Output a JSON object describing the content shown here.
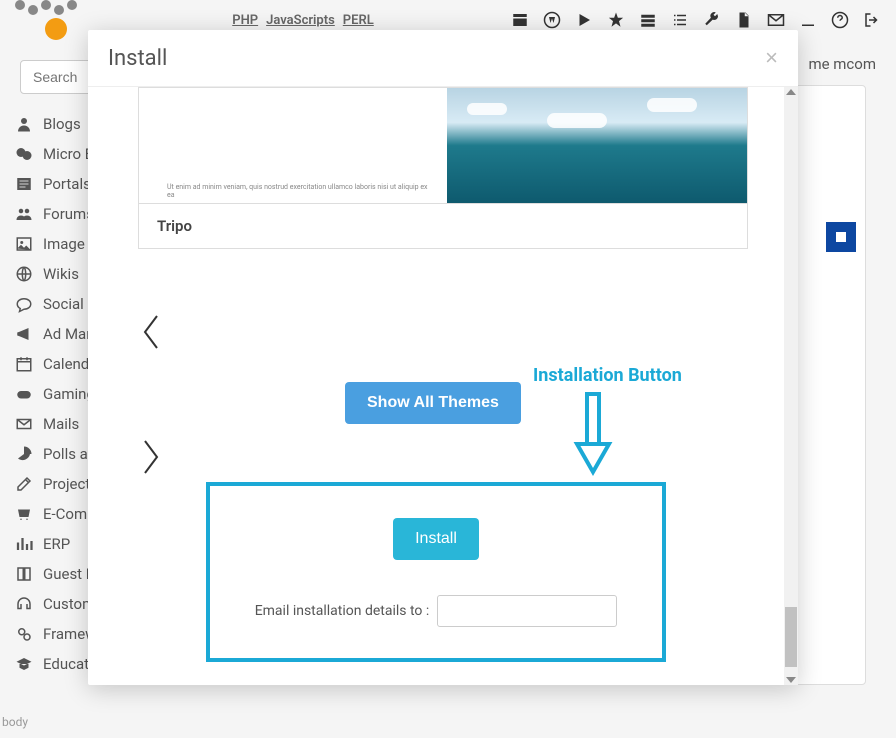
{
  "header": {
    "tabs": [
      "PHP",
      "JavaScripts",
      "PERL"
    ],
    "welcome": "me mcom"
  },
  "search": {
    "placeholder": "Search"
  },
  "sidebar": {
    "items": [
      {
        "label": "Blogs",
        "icon": "user"
      },
      {
        "label": "Micro B",
        "icon": "chat"
      },
      {
        "label": "Portals/C",
        "icon": "news"
      },
      {
        "label": "Forums",
        "icon": "users"
      },
      {
        "label": "Image G",
        "icon": "image"
      },
      {
        "label": "Wikis",
        "icon": "globe"
      },
      {
        "label": "Social N",
        "icon": "comment"
      },
      {
        "label": "Ad Mana",
        "icon": "bullhorn"
      },
      {
        "label": "Calenda",
        "icon": "calendar"
      },
      {
        "label": "Gaming",
        "icon": "gamepad"
      },
      {
        "label": "Mails",
        "icon": "mail"
      },
      {
        "label": "Polls an",
        "icon": "piechart"
      },
      {
        "label": "Project I",
        "icon": "edit"
      },
      {
        "label": "E-Comm",
        "icon": "cart"
      },
      {
        "label": "ERP",
        "icon": "barchart"
      },
      {
        "label": "Guest Bo",
        "icon": "book"
      },
      {
        "label": "Custome",
        "icon": "headset"
      },
      {
        "label": "Framewo",
        "icon": "gears"
      },
      {
        "label": "Educational",
        "icon": "gradcap"
      }
    ]
  },
  "modal": {
    "title": "Install",
    "theme_name": "Tripo",
    "theme_lorem": "Ut enim ad minim veniam, quis nostrud exercitation ullamco laboris nisi ut aliquip ex ea",
    "show_all_btn": "Show All Themes",
    "annotation": "Installation Button",
    "install_btn": "Install",
    "email_label": "Email installation details to :"
  },
  "body_label": "body"
}
